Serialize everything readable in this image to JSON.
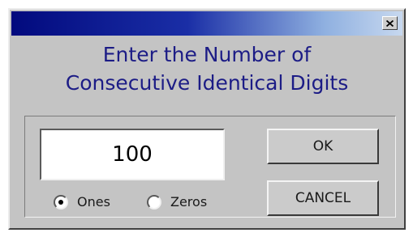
{
  "dialog": {
    "heading_line1": "Enter the Number of",
    "heading_line2": "Consecutive Identical Digits",
    "close_icon": "close-x-icon",
    "input_value": "100",
    "radio_ones_label": "Ones",
    "radio_zeros_label": "Zeros",
    "selected_radio": "Ones",
    "ok_label": "OK",
    "cancel_label": "CANCEL"
  },
  "colors": {
    "title_bar_start": "#020a7e",
    "title_bar_end": "#c7d8ef",
    "heading_text": "#1c1c86",
    "dialog_background": "#c4c4c4"
  }
}
